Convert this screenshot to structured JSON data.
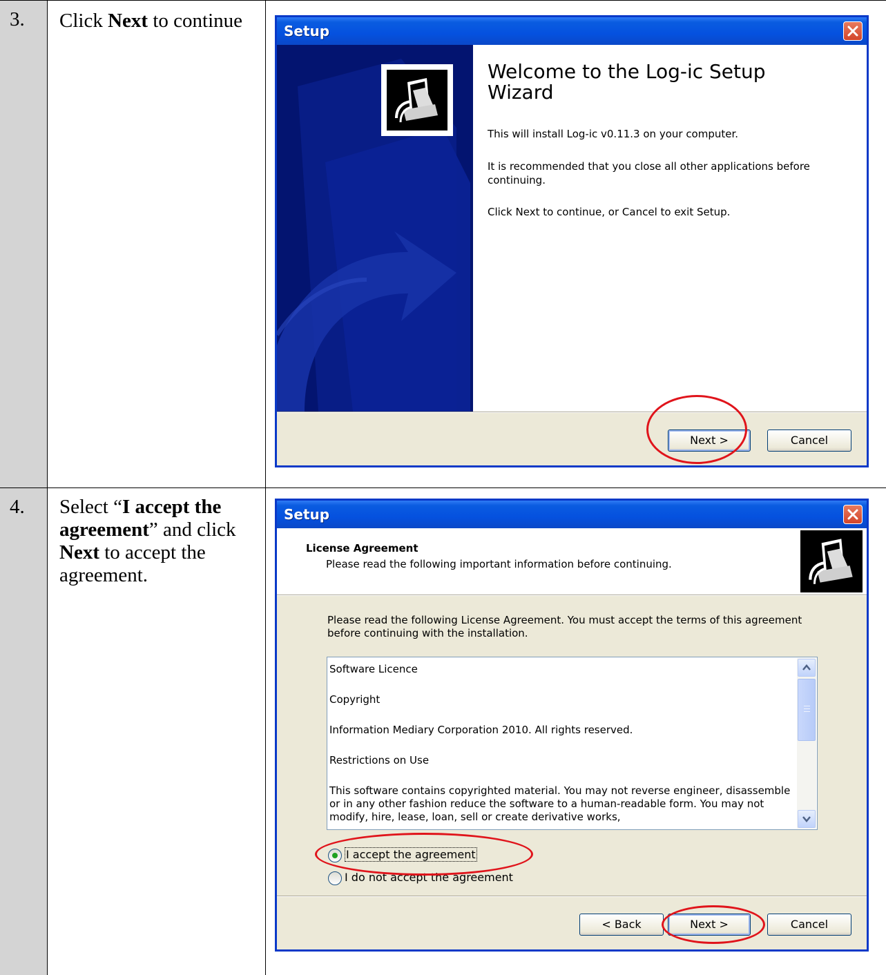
{
  "steps": [
    {
      "number": "3.",
      "text_parts": [
        "Click ",
        "Next",
        " to continue"
      ],
      "dialog": {
        "title": "Setup",
        "heading": "Welcome to the Log-ic Setup Wizard",
        "lines": [
          "This will install Log-ic v0.11.3 on your computer.",
          "It is recommended that you close all other applications before continuing.",
          "Click Next to continue, or Cancel to exit Setup."
        ],
        "next_label": "Next >",
        "cancel_label": "Cancel"
      }
    },
    {
      "number": "4.",
      "text_parts": [
        "Select “",
        "I accept the agreement",
        "” and click ",
        "Next",
        " to accept the agreement."
      ],
      "dialog": {
        "title": "Setup",
        "section_title": "License Agreement",
        "section_subtitle": "Please read the following important information before continuing.",
        "intro": "Please read the following License Agreement. You must accept the terms of this agreement before continuing with the installation.",
        "license_lines": [
          "Software Licence",
          "Copyright",
          "Information Mediary Corporation 2010. All rights reserved.",
          "Restrictions on Use",
          "This software contains copyrighted material. You may not reverse engineer, disassemble or in any other fashion reduce the software to a human-readable form. You may not modify, hire, lease, loan, sell or create derivative works,"
        ],
        "radio_accept": "I accept the agreement",
        "radio_decline": "I do not accept the agreement",
        "accept_selected": true,
        "back_label": "< Back",
        "next_label": "Next >",
        "cancel_label": "Cancel"
      }
    }
  ],
  "colors": {
    "highlight_ring": "#e0141b",
    "title_bar": "#0551df",
    "dialog_face": "#ece9d8"
  }
}
